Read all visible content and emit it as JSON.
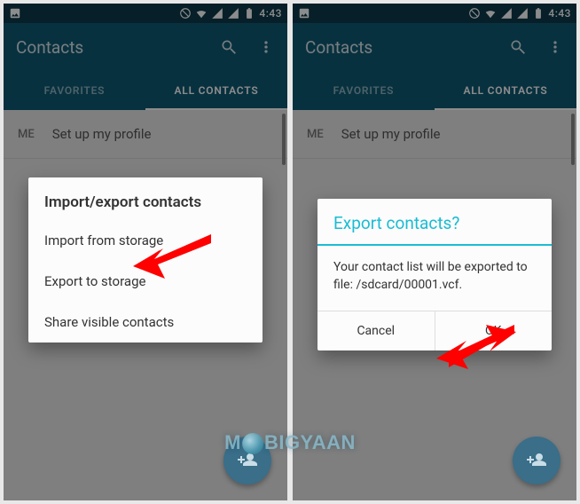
{
  "statusbar": {
    "time": "4:43"
  },
  "appbar": {
    "title": "Contacts"
  },
  "tabs": {
    "favorites": "FAVORITES",
    "all_contacts": "ALL CONTACTS"
  },
  "me_row": {
    "label": "ME",
    "setup": "Set up my profile"
  },
  "dialog_left": {
    "title": "Import/export contacts",
    "items": [
      "Import from storage",
      "Export to storage",
      "Share visible contacts"
    ]
  },
  "dialog_right": {
    "title": "Export contacts?",
    "message": "Your contact list will be exported to file: /sdcard/00001.vcf.",
    "cancel": "Cancel",
    "ok": "OK"
  },
  "watermark": {
    "pre": "M",
    "post": "BIGYAAN"
  }
}
